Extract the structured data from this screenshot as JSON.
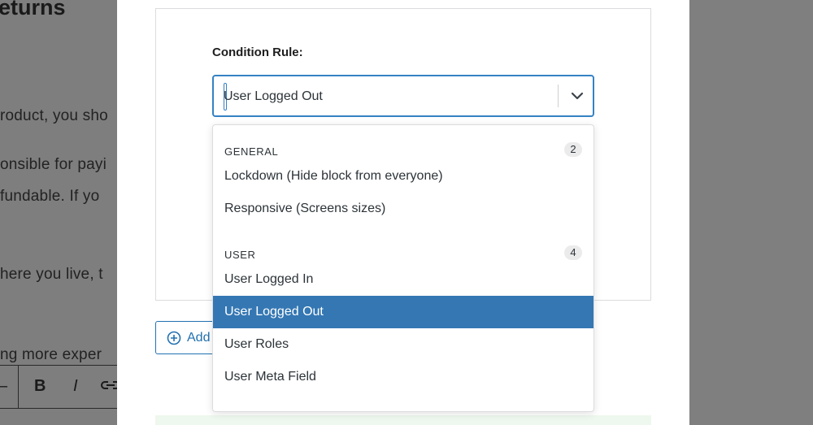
{
  "background": {
    "title": "eturns",
    "lines": [
      "roduct, you sho",
      "onsible for payi",
      "fundable. If yo",
      "here you live, t",
      "ng more exper"
    ],
    "toolbar": {
      "bold": "B",
      "italic": "I"
    }
  },
  "condition": {
    "label": "Condition Rule:",
    "selected_value": "User Logged Out"
  },
  "add_button": {
    "label": "Add"
  },
  "menu": {
    "groups": [
      {
        "name": "GENERAL",
        "count": "2",
        "options": [
          "Lockdown (Hide block from everyone)",
          "Responsive (Screens sizes)"
        ]
      },
      {
        "name": "USER",
        "count": "4",
        "options": [
          "User Logged In",
          "User Logged Out",
          "User Roles",
          "User Meta Field"
        ]
      }
    ]
  },
  "colors": {
    "accent": "#3582c4",
    "selected_bg": "#3477b3",
    "overlay": "#7f7f7f"
  }
}
